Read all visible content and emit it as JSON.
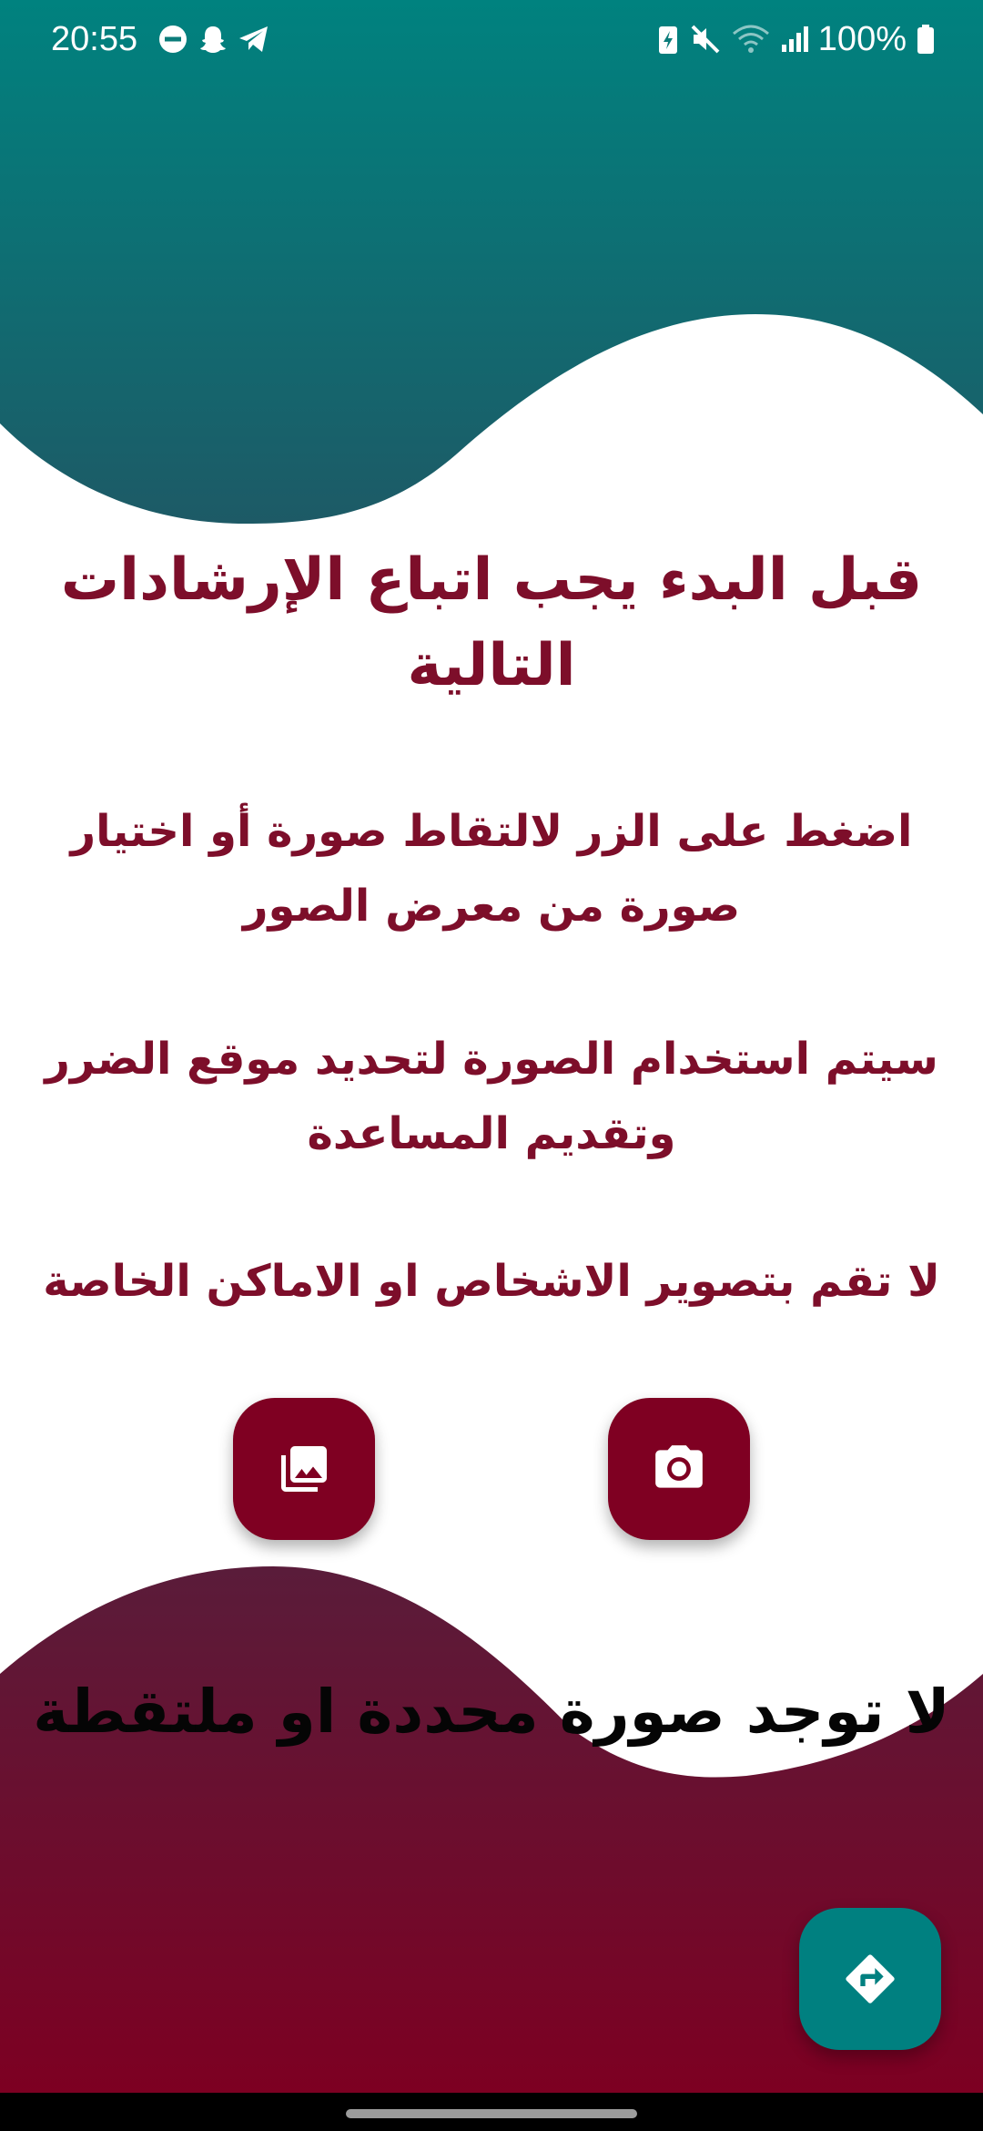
{
  "status_bar": {
    "time": "20:55",
    "battery_percent": "100%",
    "left_icons": [
      "do-not-disturb-icon",
      "snapchat-icon",
      "telegram-icon"
    ],
    "right_icons": [
      "battery-saver-icon",
      "mute-icon",
      "wifi-icon",
      "signal-icon",
      "battery-icon"
    ]
  },
  "content": {
    "title": "قبل البدء يجب اتباع الإرشادات التالية",
    "instructions": [
      "اضغط على الزر لالتقاط صورة أو اختيار صورة من معرض الصور",
      "سيتم استخدام الصورة لتحديد موقع الضرر وتقديم المساعدة",
      "لا تقم بتصوير الاشخاص او الاماكن الخاصة"
    ],
    "no_image_message": "لا توجد صورة محددة او ملتقطة"
  },
  "buttons": {
    "gallery_icon": "photo-library-icon",
    "camera_icon": "camera-icon",
    "next_icon": "directions-icon"
  },
  "colors": {
    "teal": "#008080",
    "maroon": "#7f0022",
    "text_maroon": "#7d0e2a"
  }
}
